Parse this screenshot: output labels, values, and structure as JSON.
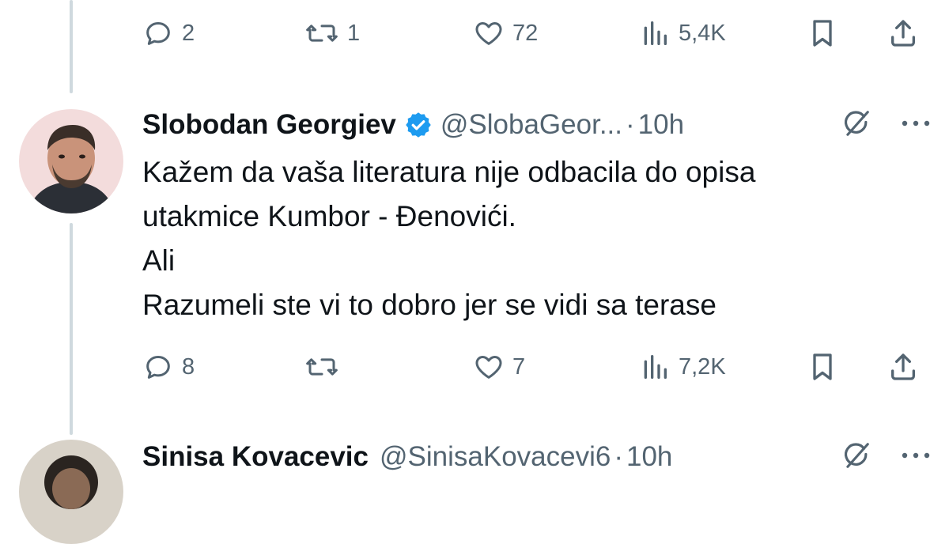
{
  "top_actions": {
    "reply_count": "2",
    "retweet_count": "1",
    "like_count": "72",
    "views_count": "5,4K"
  },
  "tweet1": {
    "author_name": "Slobodan Georgiev",
    "handle": "@SlobaGeor...",
    "separator": "·",
    "time": "10h",
    "lines": [
      "Kažem da vaša literatura nije odbacila do opisa",
      "utakmice Kumbor - Đenovići.",
      "Ali",
      "Razumeli ste vi to dobro jer se vidi sa terase"
    ],
    "actions": {
      "reply_count": "8",
      "retweet_count": "",
      "like_count": "7",
      "views_count": "7,2K"
    }
  },
  "tweet2": {
    "author_name": "Sinisa Kovacevic",
    "handle": "@SinisaKovacevi6",
    "separator": "·",
    "time": "10h"
  },
  "colors": {
    "text_primary": "#0f1419",
    "text_secondary": "#536471",
    "verified_blue": "#1d9bf0",
    "thread_line": "#cfd9de"
  },
  "icons": [
    "reply-icon",
    "retweet-icon",
    "like-icon",
    "views-icon",
    "bookmark-icon",
    "share-icon",
    "verified-badge-icon",
    "grok-icon",
    "more-icon"
  ]
}
